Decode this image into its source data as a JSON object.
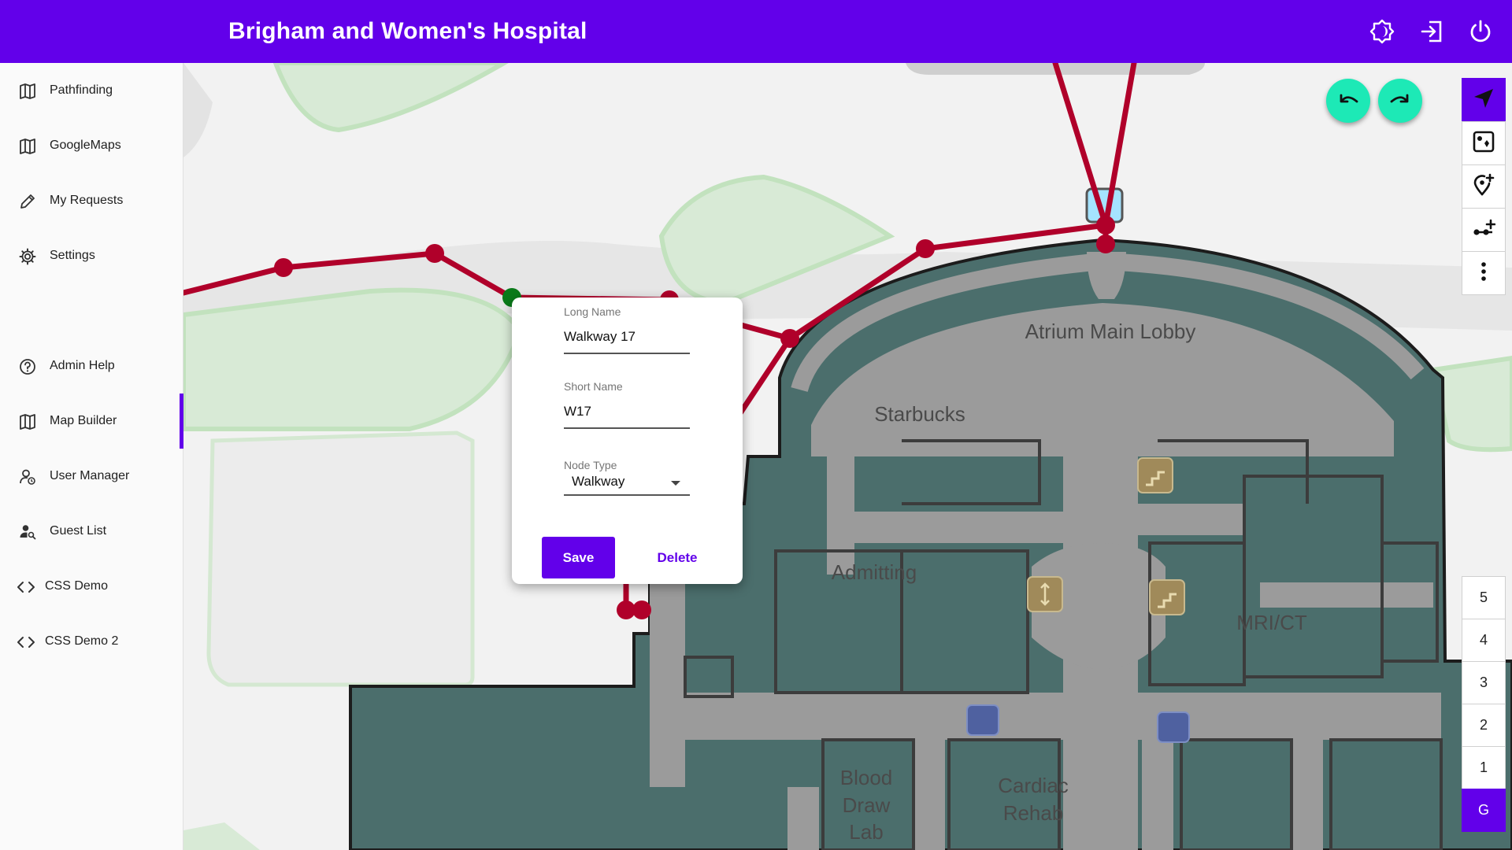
{
  "header": {
    "title": "Brigham and Women's Hospital",
    "icons": [
      "theme-toggle-icon",
      "login-icon",
      "power-icon"
    ]
  },
  "sidebar": {
    "items": [
      {
        "label": "Pathfinding",
        "icon": "map-icon"
      },
      {
        "label": "GoogleMaps",
        "icon": "map-icon"
      },
      {
        "label": "My Requests",
        "icon": "pencil-icon"
      },
      {
        "label": "Settings",
        "icon": "gear-icon"
      },
      {
        "label": "Admin Help",
        "icon": "help-icon"
      },
      {
        "label": "Map Builder",
        "icon": "map-icon",
        "active": true
      },
      {
        "label": "User Manager",
        "icon": "user-manager-icon"
      },
      {
        "label": "Guest List",
        "icon": "guest-search-icon"
      },
      {
        "label": "CSS Demo",
        "icon": "code-icon"
      },
      {
        "label": "CSS Demo 2",
        "icon": "code-icon"
      }
    ]
  },
  "map": {
    "rooms": [
      "Atrium Main Lobby",
      "Starbucks",
      "Admitting",
      "MRI/CT",
      "Blood Draw Lab",
      "Cardiac Rehab"
    ],
    "blood_lines": [
      "Blood",
      "Draw",
      "Lab"
    ],
    "cardiac_lines": [
      "Cardiac",
      "Rehab"
    ],
    "edge_color": "#b0002a",
    "selected_node_color": "#0a7a1a",
    "building_color": "#4b6e6c",
    "corridor_color": "#9b9b9b"
  },
  "history": {
    "undo": "undo-icon",
    "redo": "redo-icon"
  },
  "tools": [
    "navigate-arrow-icon",
    "map-view-icon",
    "add-node-icon",
    "add-edge-icon",
    "more-icon"
  ],
  "floors": [
    "5",
    "4",
    "3",
    "2",
    "1",
    "G"
  ],
  "active_floor": "G",
  "dialog": {
    "long_name_label": "Long Name",
    "long_name_value": "Walkway 17",
    "short_name_label": "Short Name",
    "short_name_value": "W17",
    "node_type_label": "Node Type",
    "node_type_value": "Walkway",
    "save": "Save",
    "delete": "Delete"
  }
}
